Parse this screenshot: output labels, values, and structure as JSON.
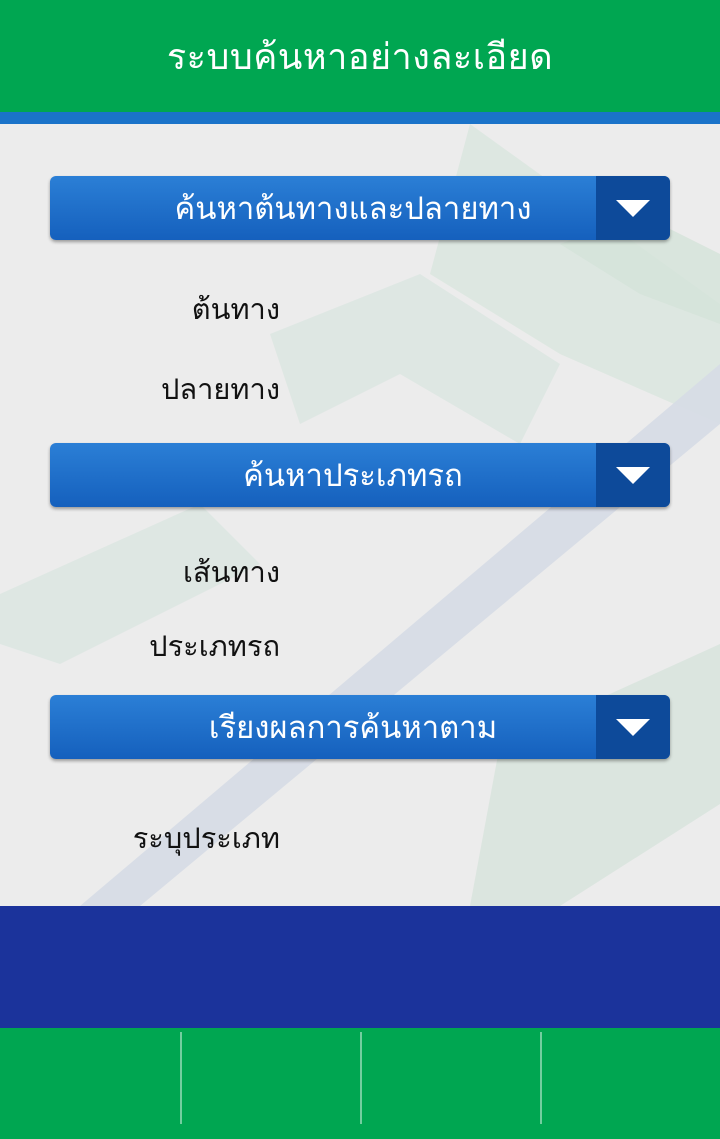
{
  "header": {
    "title": "ระบบค้นหาอย่างละเอียด"
  },
  "sections": [
    {
      "label": "ค้นหาต้นทางและปลายทาง",
      "fields": [
        {
          "label": "ต้นทาง",
          "value": ""
        },
        {
          "label": "ปลายทาง",
          "value": ""
        }
      ]
    },
    {
      "label": "ค้นหาประเภทรถ",
      "fields": [
        {
          "label": "เส้นทาง",
          "value": ""
        },
        {
          "label": "ประเภทรถ",
          "value": ""
        }
      ]
    },
    {
      "label": "เรียงผลการค้นหาตาม",
      "fields": [
        {
          "label": "ระบุประเภท",
          "value": ""
        }
      ]
    }
  ],
  "colors": {
    "header_green": "#00a651",
    "accent_blue": "#1a73c9",
    "band_navy": "#1b339b",
    "dropdown_dark": "#0d4a9a"
  }
}
